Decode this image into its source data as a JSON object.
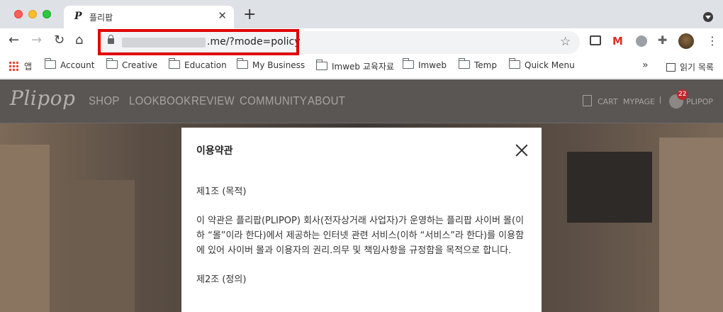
{
  "browser": {
    "tab": {
      "title": "플리팝",
      "favicon": "P"
    },
    "address_bar": {
      "url_visible": ".me/?mode=policy"
    },
    "bookmarks": [
      {
        "label": "앱",
        "icon": "apps-grid-icon"
      },
      {
        "label": "Account",
        "icon": "folder-icon"
      },
      {
        "label": "Creative",
        "icon": "folder-icon"
      },
      {
        "label": "Education",
        "icon": "folder-icon"
      },
      {
        "label": "My Business",
        "icon": "folder-icon"
      },
      {
        "label": "Imweb 교육자료",
        "icon": "folder-icon"
      },
      {
        "label": "Imweb",
        "icon": "folder-icon"
      },
      {
        "label": "Temp",
        "icon": "folder-icon"
      },
      {
        "label": "Quick Menu",
        "icon": "folder-icon"
      }
    ],
    "bookmarks_overflow": "»",
    "reading_list": "읽기 목록"
  },
  "site": {
    "logo": "Plipop",
    "menu": [
      "SHOP",
      "LOOKBOOK",
      "REVIEW",
      "COMMUNITY",
      "ABOUT"
    ],
    "utility": {
      "cart": "CART",
      "mypage": "MYPAGE",
      "separator": "I",
      "user": "PLIPOP",
      "badge_count": "22"
    }
  },
  "modal": {
    "title": "이용약관",
    "paragraphs": [
      "제1조 (목적)",
      "이 약관은 플리팝(PLIPOP) 회사(전자상거래 사업자)가 운영하는 플리팝 사이버 몰(이하 “몰”이라 한다)에서 제공하는 인터넷 관련 서비스(이하 “서비스”라 한다)를 이용함에 있어 사이버 몰과 이용자의 권리.의무 및 책임사항을 규정함을 목적으로 합니다.",
      "제2조 (정의)"
    ]
  },
  "colors": {
    "highlight": "#e00000",
    "badge": "#c1272d",
    "site_nav": "#595654"
  }
}
